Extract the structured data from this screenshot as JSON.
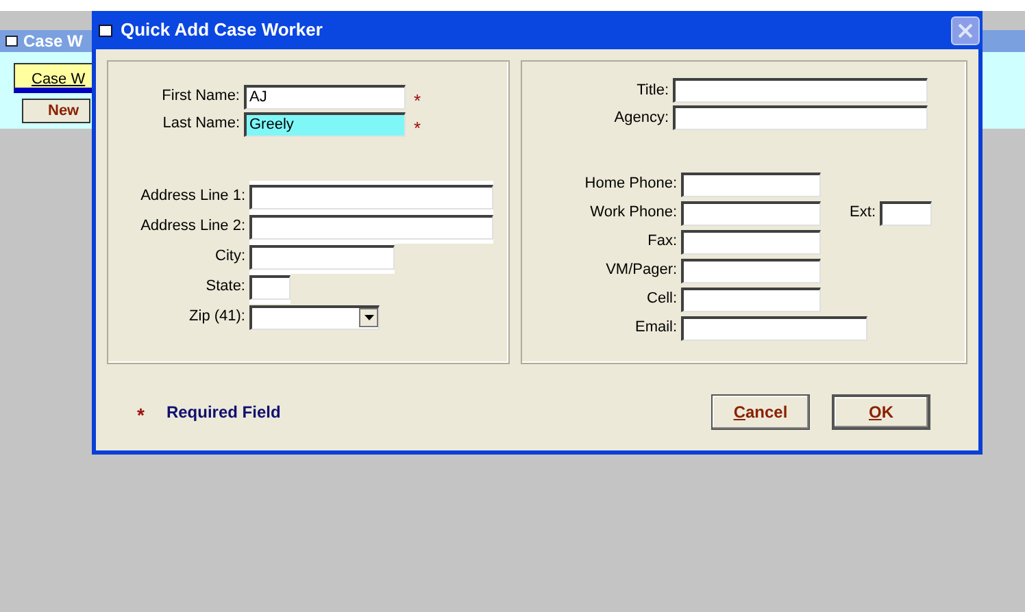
{
  "background_window": {
    "title": "Case W",
    "tab": "Case W",
    "button": "New"
  },
  "dialog": {
    "title": "Quick Add Case Worker",
    "name_fields": [
      {
        "label": "First Name:",
        "value": "AJ",
        "mark": "*",
        "focused": false
      },
      {
        "label": "Last Name:",
        "value": "Greely",
        "mark": "*",
        "focused": true
      }
    ],
    "address_fields": [
      {
        "label": "Address Line 1:",
        "kind": "text"
      },
      {
        "label": "Address Line 2:",
        "kind": "text"
      },
      {
        "label": "City:",
        "kind": "text"
      },
      {
        "label": "State:",
        "kind": "text"
      },
      {
        "label": "Zip (41):",
        "kind": "dropdown"
      }
    ],
    "contact_fields": [
      {
        "label": "Title:"
      },
      {
        "label": "Agency:"
      }
    ],
    "phone_fields": [
      {
        "label": "Home Phone:"
      },
      {
        "label": "Work Phone:",
        "extension": "Ext:"
      },
      {
        "label": "Fax:"
      },
      {
        "label": "VM/Pager:"
      },
      {
        "label": "Cell:"
      },
      {
        "label": "Email:"
      }
    ],
    "required_note": {
      "mark": "*",
      "text": "Required Field"
    },
    "buttons": [
      {
        "label": "Cancel"
      },
      {
        "label": "OK"
      }
    ]
  }
}
